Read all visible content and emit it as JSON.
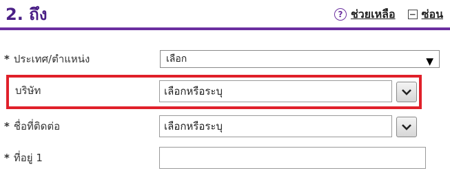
{
  "header": {
    "title": "2. ถึง",
    "help_label": "ช่วยเหลือ",
    "hide_label": "ซ่อน",
    "help_icon": "question-circle-icon",
    "hide_icon": "collapse-box-icon"
  },
  "form": {
    "required_mark": "*",
    "country": {
      "label": "ประเทศ/ตำแหน่ง",
      "value": "เลือก",
      "arrow": "▼"
    },
    "company": {
      "label": "บริษัท",
      "value": "เลือกหรือระบุ"
    },
    "contact": {
      "label": "ชื่อที่ติดต่อ",
      "value": "เลือกหรือระบุ"
    },
    "address1": {
      "label": "ที่อยู่ 1",
      "value": ""
    }
  },
  "colors": {
    "accent_purple": "#6b2fa0",
    "title_purple": "#4a1f86",
    "highlight_red": "#e0202a"
  }
}
